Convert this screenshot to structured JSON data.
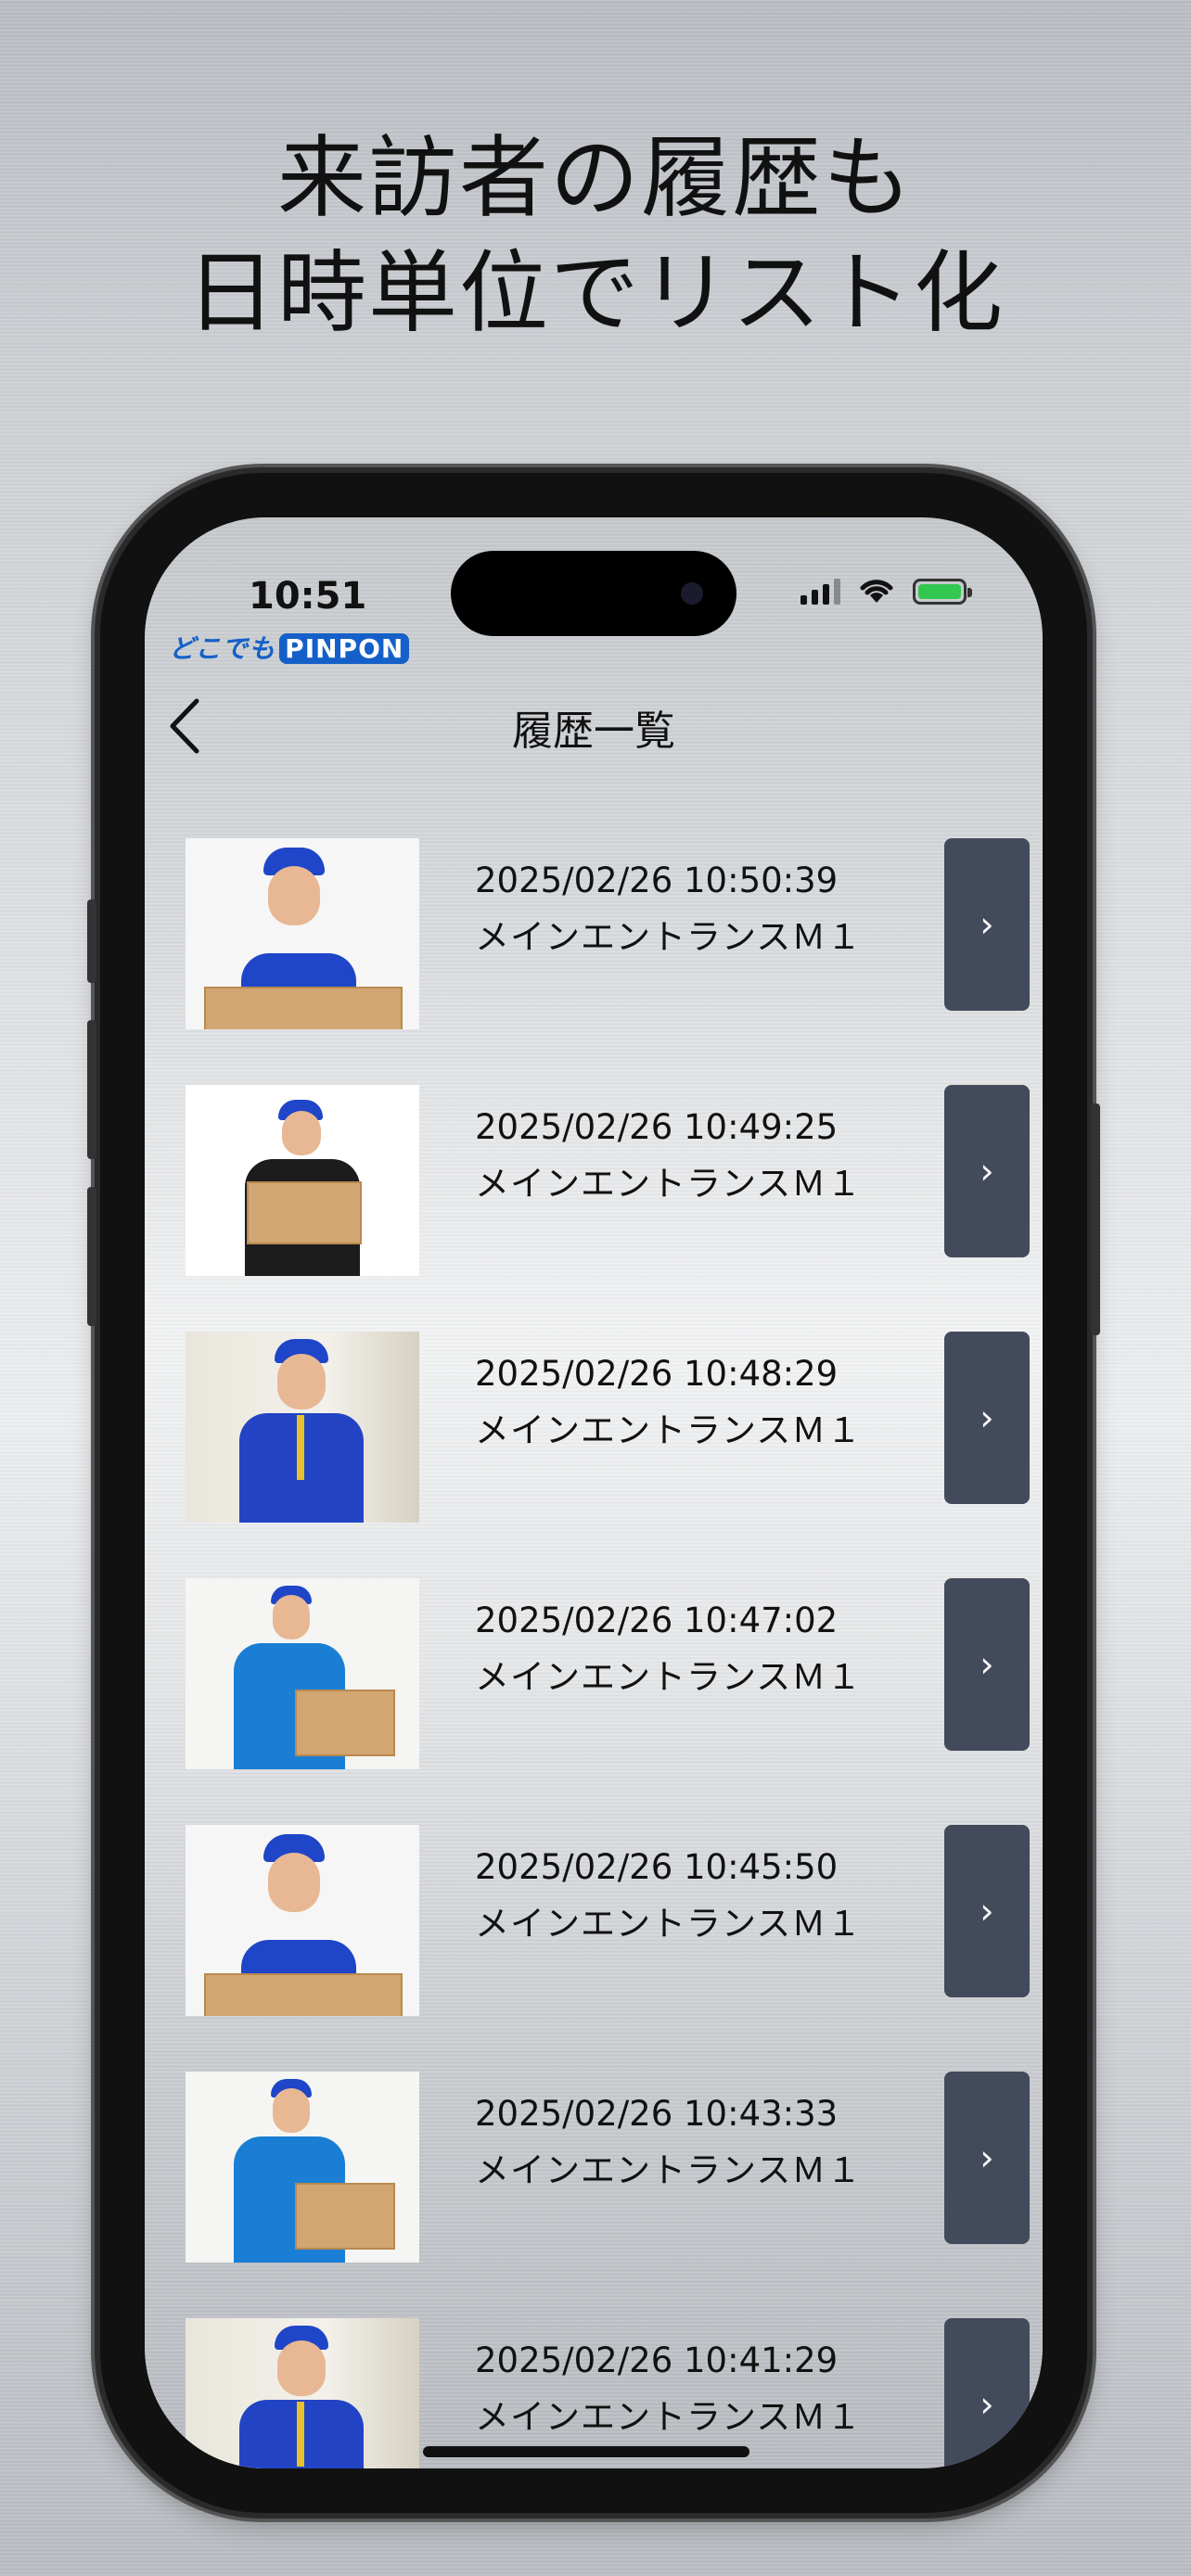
{
  "headline": {
    "line1": "来訪者の履歴も",
    "line2": "日時単位でリスト化"
  },
  "status_bar": {
    "time": "10:51"
  },
  "app": {
    "logo_text": "どこでも",
    "logo_mark": "PINPON"
  },
  "nav": {
    "title": "履歴一覧"
  },
  "history": [
    {
      "datetime": "2025/02/26 10:50:39",
      "location": "メインエントランスＭ１",
      "thumb": "woman-cap-box"
    },
    {
      "datetime": "2025/02/26 10:49:25",
      "location": "メインエントランスＭ１",
      "thumb": "man-black-shirt-box"
    },
    {
      "datetime": "2025/02/26 10:48:29",
      "location": "メインエントランスＭ１",
      "thumb": "man-lanyard-corridor"
    },
    {
      "datetime": "2025/02/26 10:47:02",
      "location": "メインエントランスＭ１",
      "thumb": "man-blue-shirt-box"
    },
    {
      "datetime": "2025/02/26 10:45:50",
      "location": "メインエントランスＭ１",
      "thumb": "woman-cap-box"
    },
    {
      "datetime": "2025/02/26 10:43:33",
      "location": "メインエントランスＭ１",
      "thumb": "man-blue-shirt-box"
    },
    {
      "datetime": "2025/02/26 10:41:29",
      "location": "メインエントランスＭ１",
      "thumb": "man-lanyard-corridor"
    }
  ],
  "detail_glyph": "›",
  "colors": {
    "detail_button": "#434a5b",
    "cap_blue": "#1f45c8",
    "logo_blue": "#1560c8",
    "battery_green": "#32c850"
  }
}
